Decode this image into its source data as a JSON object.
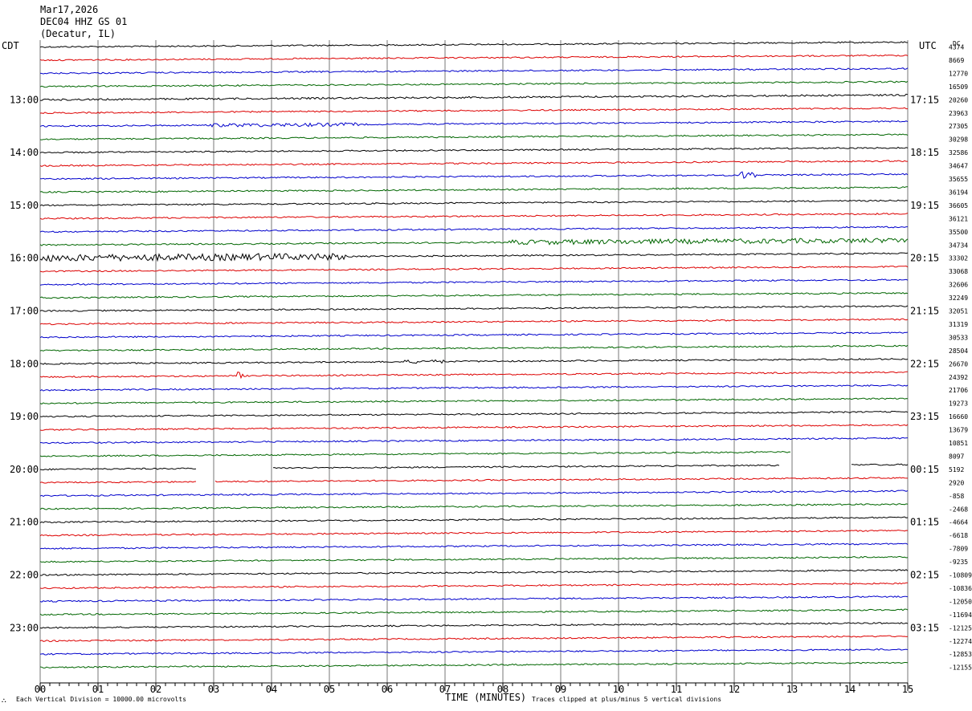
{
  "header": {
    "date": "Mar17,2026",
    "station": "DEC04 HHZ GS 01",
    "location": "(Decatur, IL)"
  },
  "left_timezone": "CDT",
  "right_timezone": "UTC",
  "dc_label": "DC",
  "xlabel": "TIME (MINUTES)",
  "footer_left": "Each Vertical Division = 10000.00 microvolts",
  "footer_right": "Traces clipped at plus/minus 5 vertical divisions",
  "chart_data": {
    "type": "line",
    "title": "",
    "xlabel": "TIME (MINUTES)",
    "x_ticks": [
      "00",
      "01",
      "02",
      "03",
      "04",
      "05",
      "06",
      "07",
      "08",
      "09",
      "10",
      "11",
      "12",
      "13",
      "14",
      "15"
    ],
    "xlim": [
      0,
      15
    ],
    "trace_count": 48,
    "trace_colors": [
      "#000000",
      "#dd0000",
      "#0000cc",
      "#006600"
    ],
    "left_hour_labels": [
      "13:00",
      "14:00",
      "15:00",
      "16:00",
      "17:00",
      "18:00",
      "19:00",
      "20:00",
      "21:00",
      "22:00",
      "23:00"
    ],
    "right_hour_labels": [
      "17:15",
      "18:15",
      "19:15",
      "20:15",
      "21:15",
      "22:15",
      "23:15",
      "00:15",
      "01:15",
      "02:15",
      "03:15"
    ],
    "first_labeled_trace": 4,
    "dc_offsets": [
      "4374",
      "8669",
      "12770",
      "16509",
      "20260",
      "23963",
      "27305",
      "30298",
      "32586",
      "34647",
      "35655",
      "36194",
      "36605",
      "36121",
      "35500",
      "34734",
      "33302",
      "33068",
      "32606",
      "32249",
      "32051",
      "31319",
      "30533",
      "28504",
      "26670",
      "24392",
      "21706",
      "19273",
      "16660",
      "13679",
      "10851",
      "8097",
      "5192",
      "2920",
      "-858",
      "-2468",
      "-4664",
      "-6618",
      "-7809",
      "-9235",
      "-10809",
      "-10836",
      "-12050",
      "-11694",
      "-12125",
      "-12274",
      "-12853",
      "-12155"
    ],
    "events": [
      {
        "trace": 4,
        "start_min": 0.0,
        "end_min": 15.0,
        "note": "steady"
      },
      {
        "trace": 6,
        "start_min": 2.9,
        "end_min": 5.5,
        "amp": "moderate"
      },
      {
        "trace": 10,
        "start_min": 12.1,
        "end_min": 12.4,
        "amp": "burst"
      },
      {
        "trace": 15,
        "start_min": 8.1,
        "end_min": 15.0,
        "amp": "elevated"
      },
      {
        "trace": 16,
        "start_min": 0.0,
        "end_min": 5.3,
        "amp": "high"
      },
      {
        "trace": 24,
        "start_min": 6.3,
        "end_min": 7.0,
        "amp": "moderate"
      },
      {
        "trace": 25,
        "start_min": 3.4,
        "end_min": 3.5,
        "amp": "spike"
      }
    ],
    "gaps": [
      {
        "trace": 31,
        "start_min": 13.0,
        "end_min": 15.0
      },
      {
        "trace": 32,
        "start_min": 2.7,
        "end_min": 4.0
      },
      {
        "trace": 32,
        "start_min": 12.8,
        "end_min": 14.0
      },
      {
        "trace": 33,
        "start_min": 2.7,
        "end_min": 3.0
      }
    ]
  }
}
